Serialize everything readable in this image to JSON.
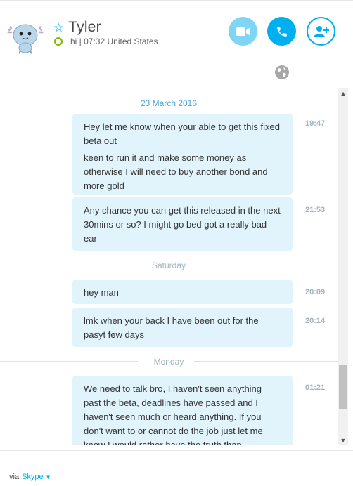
{
  "header": {
    "contact_name": "Tyler",
    "status": "hi | 07:32 United States"
  },
  "conversation": {
    "sections": [
      {
        "date": "23 March 2016",
        "messages": [
          {
            "lines": [
              "Hey let me know when your able to get this fixed beta out",
              "keen to run it and make some money as otherwise I will need to buy another bond and more gold"
            ],
            "time": "19:47"
          },
          {
            "lines": [
              "Any chance you can get this released in the next 30mins or so? I might go bed got a really bad ear"
            ],
            "time": "21:53"
          }
        ]
      },
      {
        "date": "Saturday",
        "messages": [
          {
            "lines": [
              "hey man"
            ],
            "time": "20:09"
          },
          {
            "lines": [
              "lmk when your back I have been out for the pasyt few days"
            ],
            "time": "20:14"
          }
        ]
      },
      {
        "date": "Monday",
        "messages": [
          {
            "lines": [
              "We need to talk bro, I haven't seen anything past the beta, deadlines have passed and I haven't seen much or heard anything. If you don't want to or cannot do the job just let me know I would rather have the truth than"
            ],
            "time": "01:21"
          }
        ]
      }
    ]
  },
  "footer": {
    "via_label": "via",
    "service_label": "Skype"
  },
  "colors": {
    "accent": "#00aff0",
    "bubble": "#e1f3fb",
    "presence": "#7fba00"
  },
  "icons": [
    "star-icon",
    "presence-icon",
    "video-call-icon",
    "audio-call-icon",
    "add-participant-icon",
    "globe-icon",
    "scroll-up-icon",
    "scroll-down-icon",
    "caret-down-icon"
  ]
}
